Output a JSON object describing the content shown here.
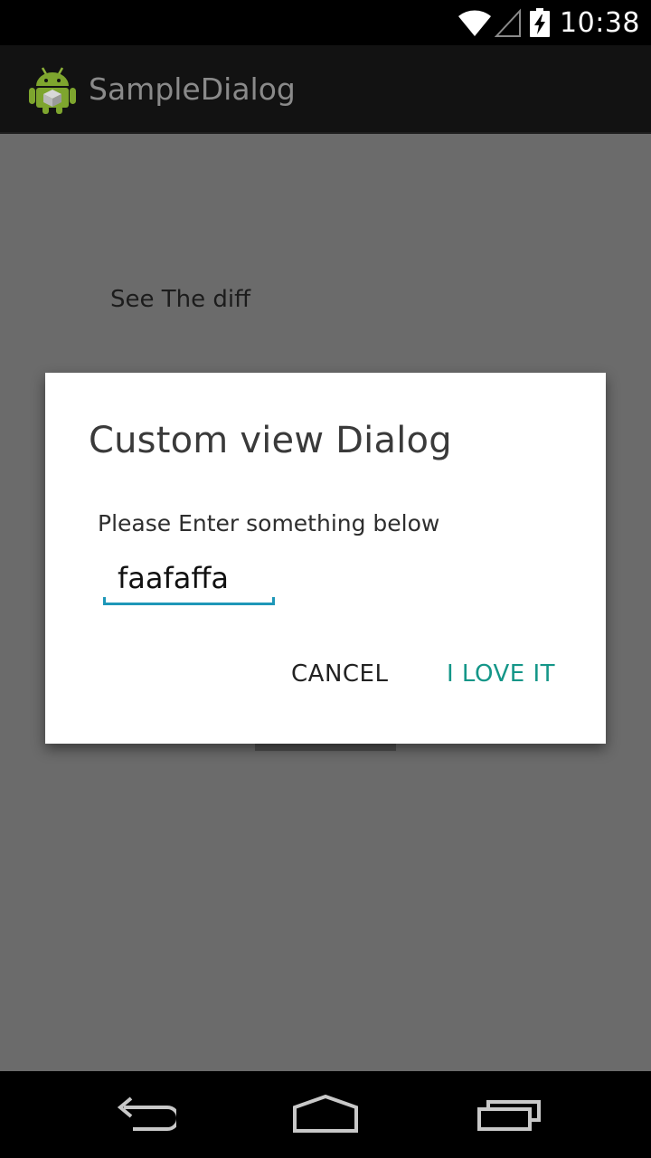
{
  "status_bar": {
    "time": "10:38",
    "icons": [
      "wifi-icon",
      "signal-icon",
      "battery-charging-icon"
    ]
  },
  "action_bar": {
    "title": "SampleDialog",
    "icon": "android-app-icon"
  },
  "content": {
    "text": "See The diff"
  },
  "dialog": {
    "title": "Custom view Dialog",
    "message": "Please Enter something below",
    "input_value": "faafaffa",
    "cancel_label": "CANCEL",
    "ok_label": "I LOVE IT"
  },
  "nav_bar": {
    "icons": [
      "back-icon",
      "home-icon",
      "recent-apps-icon"
    ]
  },
  "colors": {
    "accent": "#149688",
    "field_underline": "#1e97b8",
    "scrim": "#6b6b6b"
  }
}
